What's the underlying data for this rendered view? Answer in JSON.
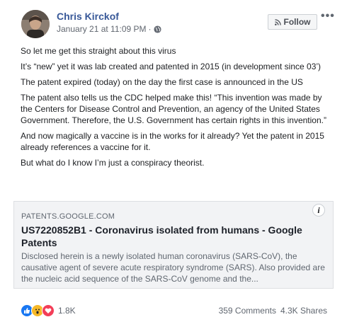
{
  "post": {
    "author": "Chris Kirckof",
    "timestamp": "January 21 at 11:09 PM",
    "timestamp_separator": "·",
    "privacy_icon": "globe-icon",
    "follow_label": "Follow",
    "more_label": "•••",
    "paragraphs": [
      "So let me get this straight about this virus",
      "It’s “new” yet it was lab created and patented in 2015 (in development since 03’)",
      "The patent expired (today) on the day the first case is announced in the US",
      "The patent also tells us the CDC helped make this! “This invention was made by the Centers for Disease Control and Prevention, an agency of the United States Government. Therefore, the U.S. Government has certain rights in this invention.”",
      "And now magically a vaccine is in the works for it already? Yet the patent in 2015 already references a vaccine for it.",
      "But what do I know I’m just a conspiracy theorist."
    ]
  },
  "link_card": {
    "domain": "PATENTS.GOOGLE.COM",
    "title": "US7220852B1 - Coronavirus isolated from humans - Google Patents",
    "description": "Disclosed herein is a newly isolated human coronavirus (SARS-CoV), the causative agent of severe acute respiratory syndrome (SARS). Also provided are the nucleic acid sequence of the SARS-CoV genome and the...",
    "info_label": "i"
  },
  "footer": {
    "reaction_icons": [
      "like-icon",
      "wow-icon",
      "love-icon"
    ],
    "reaction_count": "1.8K",
    "comments": "359 Comments",
    "shares": "4.3K Shares"
  },
  "colors": {
    "author": "#385898",
    "like": "#1877f2",
    "wow": "#f7b928",
    "love": "#f33e58"
  }
}
